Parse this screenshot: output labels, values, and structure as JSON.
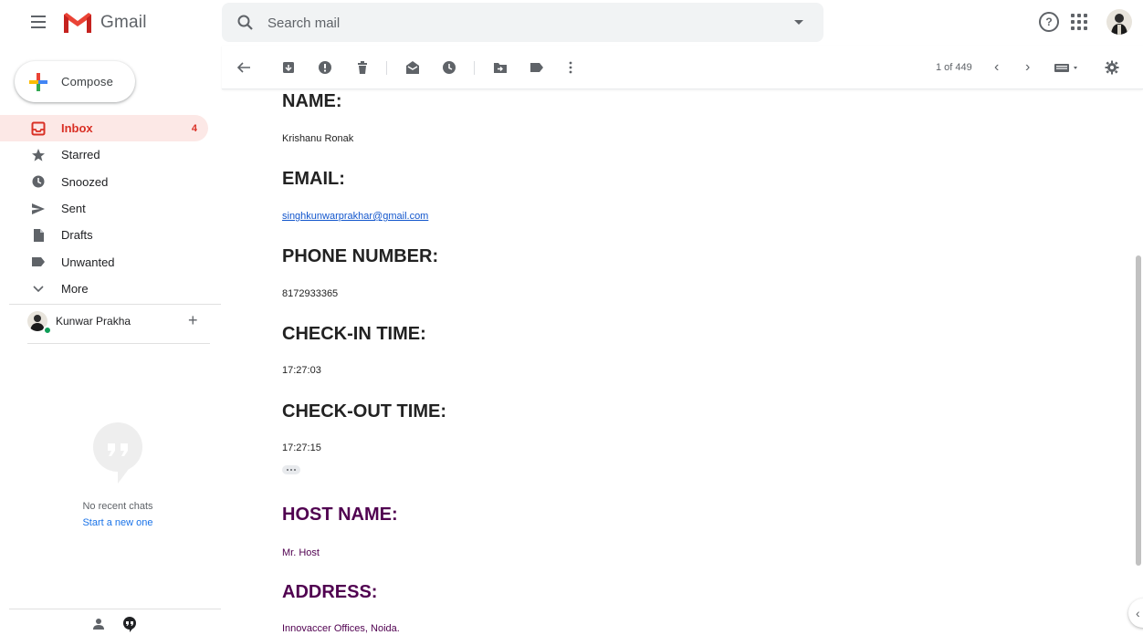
{
  "header": {
    "logo_text": "Gmail",
    "search_placeholder": "Search mail"
  },
  "compose_label": "Compose",
  "nav": [
    {
      "label": "Inbox",
      "count": "4",
      "icon": "inbox-icon"
    },
    {
      "label": "Starred",
      "count": "",
      "icon": "star-icon"
    },
    {
      "label": "Snoozed",
      "count": "",
      "icon": "clock-icon"
    },
    {
      "label": "Sent",
      "count": "",
      "icon": "send-icon"
    },
    {
      "label": "Drafts",
      "count": "",
      "icon": "draft-icon"
    },
    {
      "label": "Unwanted",
      "count": "",
      "icon": "label-icon"
    },
    {
      "label": "More",
      "count": "",
      "icon": "chevron-down-icon"
    }
  ],
  "hangouts": {
    "user_name": "Kunwar Prakha",
    "no_chats": "No recent chats",
    "start_new": "Start a new one"
  },
  "toolbar": {
    "page_count": "1 of 449"
  },
  "email": {
    "fields": [
      {
        "heading": "NAME:",
        "value": "Krishanu Ronak"
      },
      {
        "heading": "EMAIL:",
        "value": "singhkunwarprakhar@gmail.com"
      },
      {
        "heading": "PHONE NUMBER:",
        "value": "8172933365"
      },
      {
        "heading": "CHECK-IN TIME:",
        "value": "17:27:03"
      },
      {
        "heading": "CHECK-OUT TIME:",
        "value": "17:27:15"
      },
      {
        "heading": "HOST NAME:",
        "value": "Mr. Host"
      },
      {
        "heading": "ADDRESS:",
        "value": "Innovaccer Offices, Noida."
      }
    ]
  },
  "colors": {
    "accent_red": "#d93025",
    "inbox_active_bg": "#fce8e6",
    "quoted_purple": "#500050",
    "link_blue": "#1155cc"
  }
}
